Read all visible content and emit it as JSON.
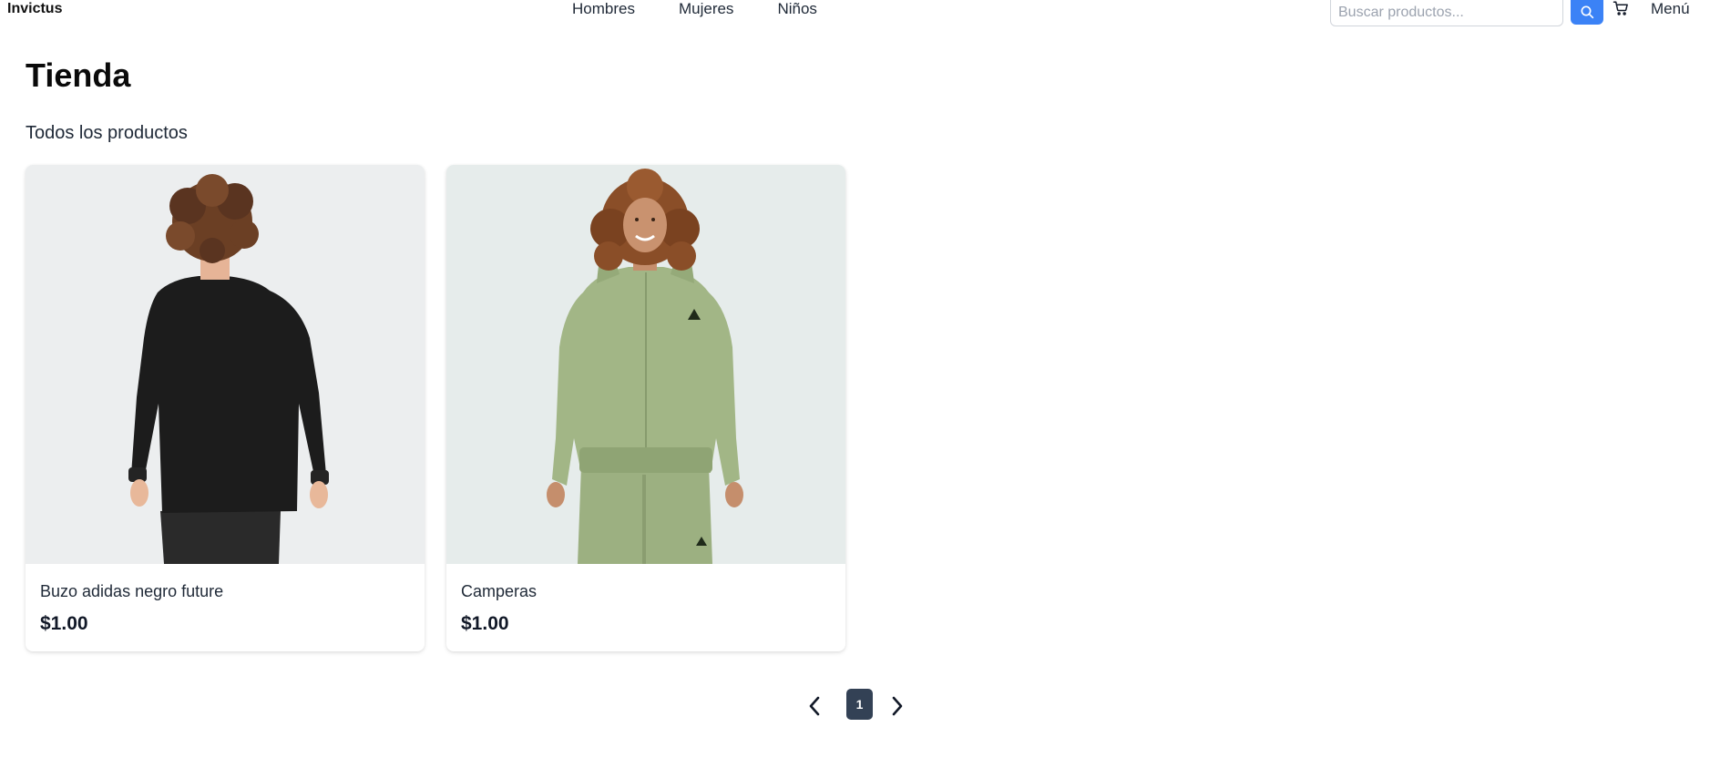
{
  "header": {
    "brand": "Invictus",
    "nav": [
      "Hombres",
      "Mujeres",
      "Niños"
    ],
    "search_placeholder": "Buscar productos...",
    "search_value": "",
    "menu_label": "Menú"
  },
  "main": {
    "title": "Tienda",
    "subtitle": "Todos los productos",
    "products": [
      {
        "name": "Buzo adidas negro future",
        "price": "$1.00"
      },
      {
        "name": "Camperas",
        "price": "$1.00"
      }
    ]
  },
  "pagination": {
    "current_page": "1"
  },
  "colors": {
    "accent": "#3b82f6",
    "page_active": "#334155",
    "image_bg_1": "#eceeef",
    "image_bg_2": "#e6eceb",
    "sweater": "#1c1c1c",
    "jacket": "#a2b686"
  },
  "icons": {
    "search": "search-icon",
    "cart": "cart-icon",
    "prev": "chevron-left-icon",
    "next": "chevron-right-icon"
  }
}
